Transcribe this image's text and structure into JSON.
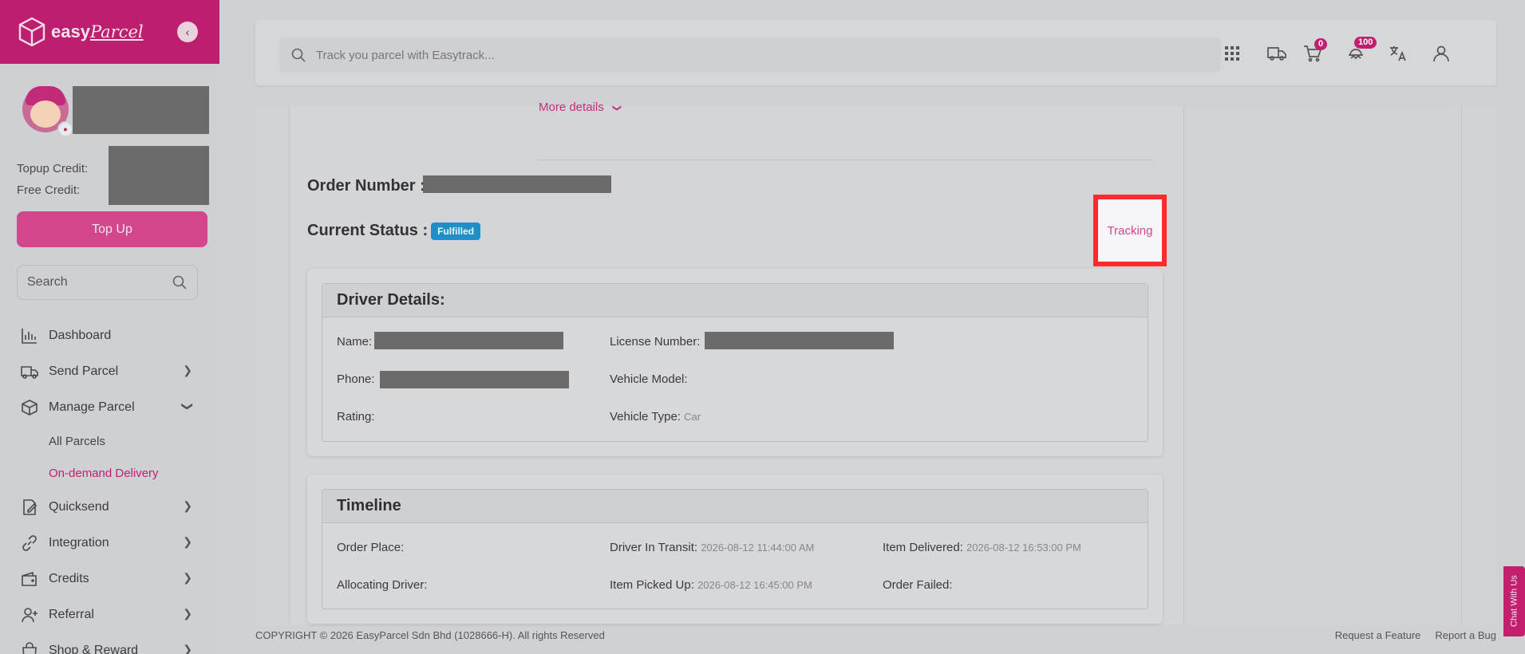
{
  "brand": {
    "name": "easy",
    "script": "Parcel"
  },
  "sidebar": {
    "topup_credit_label": "Topup Credit:",
    "free_credit_label": "Free Credit:",
    "topup_button": "Top Up",
    "search_placeholder": "Search",
    "items": [
      {
        "label": "Dashboard",
        "icon": "chart-icon"
      },
      {
        "label": "Send Parcel",
        "icon": "truck-icon"
      },
      {
        "label": "Manage Parcel",
        "icon": "box-icon",
        "expanded": true
      },
      {
        "label": "Quicksend",
        "icon": "pen-icon"
      },
      {
        "label": "Integration",
        "icon": "link-icon"
      },
      {
        "label": "Credits",
        "icon": "wallet-icon"
      },
      {
        "label": "Referral",
        "icon": "user-plus-icon"
      },
      {
        "label": "Shop & Reward",
        "icon": "bag-icon"
      }
    ],
    "sub_items": [
      {
        "label": "All Parcels",
        "active": false
      },
      {
        "label": "On-demand Delivery",
        "active": true
      }
    ]
  },
  "header": {
    "search_placeholder": "Track you parcel with Easytrack...",
    "cart_count": "0",
    "notification_count": "100"
  },
  "order": {
    "more_details": "More details",
    "order_number_label": "Order Number :",
    "current_status_label": "Current Status :",
    "status": "Fulfilled",
    "tracking_label": "Tracking"
  },
  "driver": {
    "title": "Driver Details:",
    "name_label": "Name:",
    "license_label": "License Number:",
    "phone_label": "Phone:",
    "vehicle_model_label": "Vehicle Model:",
    "rating_label": "Rating:",
    "vehicle_type_label": "Vehicle Type:",
    "vehicle_type": "Car"
  },
  "timeline": {
    "title": "Timeline",
    "order_place_label": "Order Place:",
    "driver_in_transit_label": "Driver In Transit:",
    "driver_in_transit": "2026-08-12 11:44:00 AM",
    "item_delivered_label": "Item Delivered:",
    "item_delivered": "2026-08-12 16:53:00 PM",
    "allocating_driver_label": "Allocating Driver:",
    "item_picked_up_label": "Item Picked Up:",
    "item_picked_up": "2026-08-12 16:45:00 PM",
    "order_failed_label": "Order Failed:"
  },
  "footer": {
    "copyright": "COPYRIGHT © 2026 EasyParcel Sdn Bhd (1028666-H). All rights Reserved",
    "request_feature": "Request a Feature",
    "report_bug": "Report a Bug"
  },
  "chat": {
    "label": "Chat With Us"
  }
}
